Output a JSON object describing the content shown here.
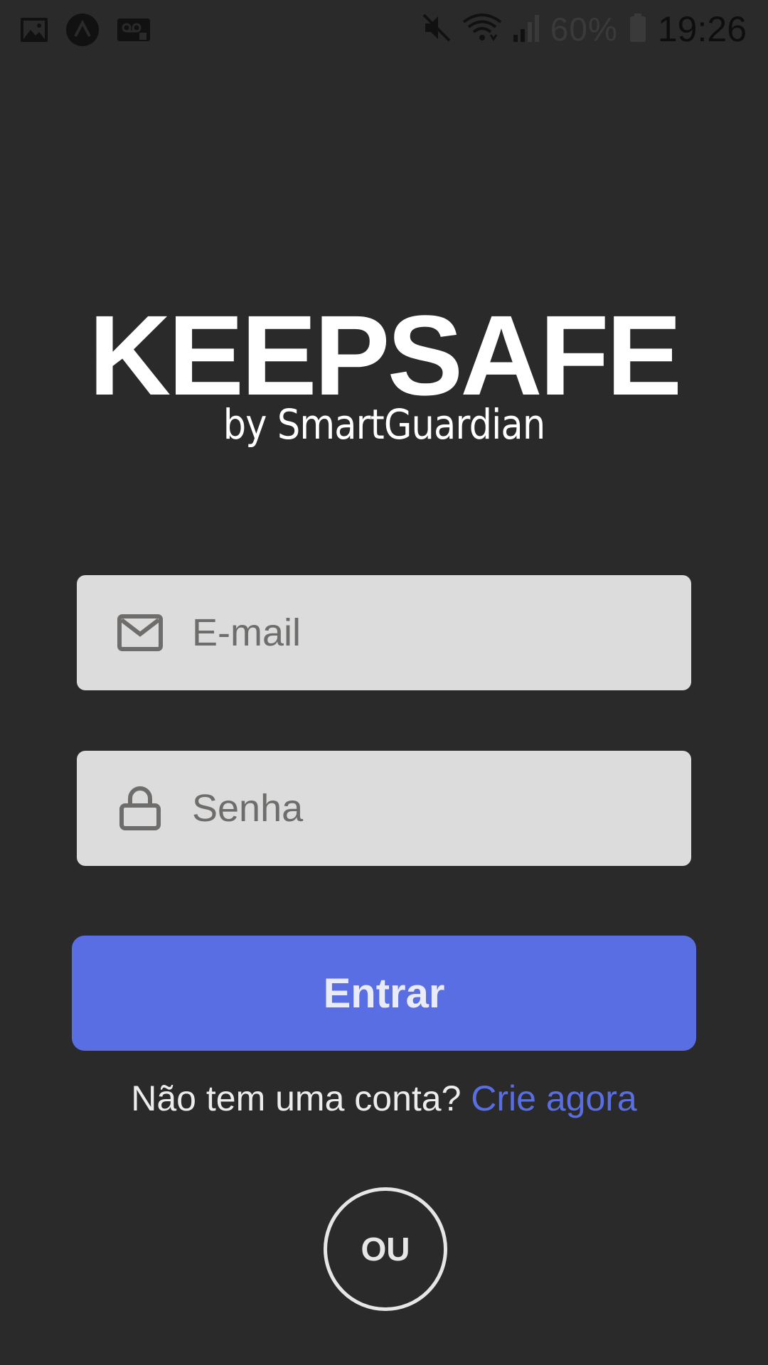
{
  "status_bar": {
    "left_icons": [
      "gallery-icon",
      "app-logo-icon",
      "voicemail-icon"
    ],
    "right_icons": [
      "mute-icon",
      "wifi-icon",
      "signal-icon",
      "battery-icon"
    ],
    "battery": "60%",
    "time": "19:26"
  },
  "logo": {
    "title": "KEEPSAFE",
    "subtitle": "by SmartGuardian"
  },
  "form": {
    "email_placeholder": "E-mail",
    "email_value": "",
    "email_icon": "mail-icon",
    "password_placeholder": "Senha",
    "password_value": "",
    "password_icon": "lock-icon",
    "submit_label": "Entrar"
  },
  "signup": {
    "prompt": "Não tem uma conta?",
    "link_label": "Crie agora"
  },
  "divider": {
    "label": "OU"
  },
  "colors": {
    "background": "#2a2a2b",
    "accent": "#5a6ee3",
    "field": "#dcdcdc",
    "text_light": "#ececec"
  }
}
